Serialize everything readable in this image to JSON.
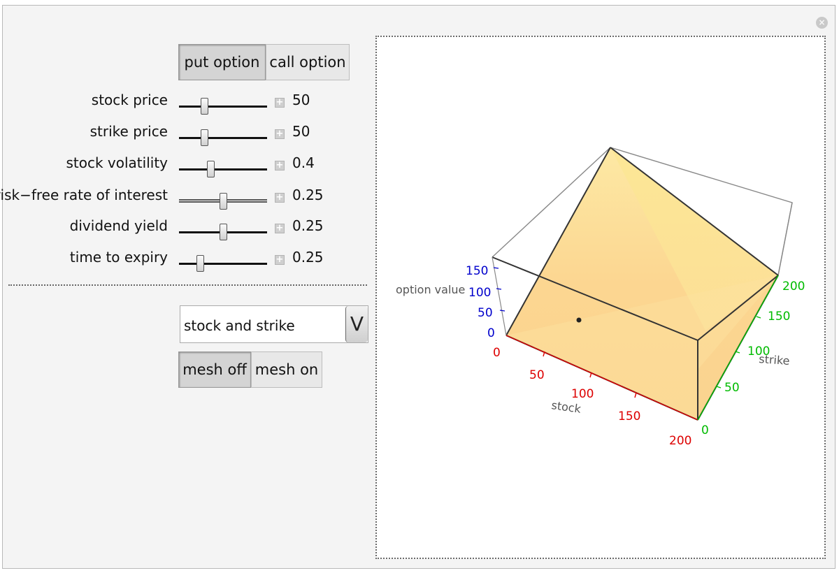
{
  "close_icon": "close-icon",
  "option_type": {
    "options": [
      "put option",
      "call option"
    ],
    "selected": "put option"
  },
  "controls": [
    {
      "label": "stock price",
      "value": "50",
      "fraction": 0.26
    },
    {
      "label": "strike price",
      "value": "50",
      "fraction": 0.26
    },
    {
      "label": "stock volatility",
      "value": "0.4",
      "fraction": 0.33
    },
    {
      "label": "risk−free rate of interest",
      "value": "0.25",
      "fraction": 0.48
    },
    {
      "label": "dividend yield",
      "value": "0.25",
      "fraction": 0.48
    },
    {
      "label": "time to expiry",
      "value": "0.25",
      "fraction": 0.21
    }
  ],
  "plot_mode": {
    "selected": "stock and strike"
  },
  "mesh": {
    "options": [
      "mesh off",
      "mesh on"
    ],
    "selected": "mesh off"
  },
  "plot": {
    "zlabel": "option value",
    "xlabel": "stock",
    "ylabel": "strike",
    "z_ticks": [
      "150",
      "100",
      "50",
      "0"
    ],
    "x_ticks": [
      "0",
      "50",
      "100",
      "150",
      "200"
    ],
    "y_ticks": [
      "200",
      "150",
      "100",
      "50",
      "0"
    ],
    "colors": {
      "z_axis": "#0000cc",
      "x_axis": "#dd0000",
      "y_axis": "#00cc00",
      "surface": "#fbe28a"
    }
  }
}
